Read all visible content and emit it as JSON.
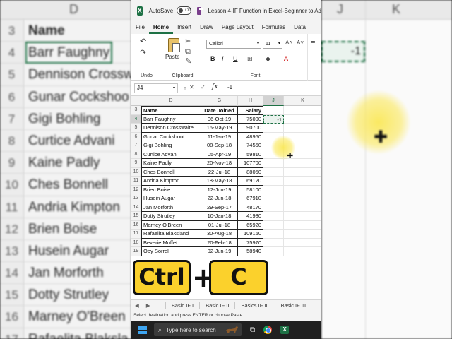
{
  "app": {
    "autosave_label": "AutoSave",
    "autosave_state": "Off",
    "doc_title": "Lesson 4-IF Function in Excel-Beginner to Ad"
  },
  "menu_tabs": [
    "File",
    "Home",
    "Insert",
    "Draw",
    "Page Layout",
    "Formulas",
    "Data"
  ],
  "ribbon": {
    "paste_label": "Paste",
    "undo_group": "Undo",
    "clipboard_group": "Clipboard",
    "font_group": "Font",
    "font_name": "Calibri",
    "font_size": "11",
    "bold": "B",
    "italic": "I",
    "underline": "U"
  },
  "formula_bar": {
    "cell_ref": "J4",
    "fx": "fx",
    "value": "-1"
  },
  "grid": {
    "columns": [
      "D",
      "G",
      "H",
      "J",
      "K"
    ],
    "selected_col": "J",
    "header_row": {
      "row": "3",
      "name": "Name",
      "date": "Date Joined",
      "salary": "Salary"
    },
    "rows": [
      {
        "row": "4",
        "name": "Barr Faughny",
        "date": "06-Oct-19",
        "salary": "75000",
        "j": "-1"
      },
      {
        "row": "5",
        "name": "Dennison Crosswaite",
        "date": "16-May-19",
        "salary": "90700"
      },
      {
        "row": "6",
        "name": "Gunar Cockshoot",
        "date": "11-Jan-19",
        "salary": "48950"
      },
      {
        "row": "7",
        "name": "Gigi Bohling",
        "date": "08-Sep-18",
        "salary": "74550"
      },
      {
        "row": "8",
        "name": "Curtice Advani",
        "date": "05-Apr-19",
        "salary": "59810"
      },
      {
        "row": "9",
        "name": "Kaine Padly",
        "date": "20-Nov-18",
        "salary": "107700"
      },
      {
        "row": "10",
        "name": "Ches Bonnell",
        "date": "22-Jul-18",
        "salary": "88050"
      },
      {
        "row": "11",
        "name": "Andria Kimpton",
        "date": "18-May-18",
        "salary": "69120"
      },
      {
        "row": "12",
        "name": "Brien Boise",
        "date": "12-Jun-19",
        "salary": "58100"
      },
      {
        "row": "13",
        "name": "Husein Augar",
        "date": "22-Jun-18",
        "salary": "67910"
      },
      {
        "row": "14",
        "name": "Jan Morforth",
        "date": "29-Sep-17",
        "salary": "48170"
      },
      {
        "row": "15",
        "name": "Dotty Strutley",
        "date": "10-Jan-18",
        "salary": "41980"
      },
      {
        "row": "16",
        "name": "Marney O'Breen",
        "date": "01-Jul-18",
        "salary": "65920"
      },
      {
        "row": "17",
        "name": "Rafaelita Blaksland",
        "date": "30-Aug-18",
        "salary": "109160"
      },
      {
        "row": "18",
        "name": "Beverie Moffet",
        "date": "20-Feb-18",
        "salary": "75970"
      },
      {
        "row": "19",
        "name": "Oby Sorrel",
        "date": "02-Jun-19",
        "salary": "58940"
      }
    ]
  },
  "overlay_keys": {
    "ctrl": "Ctrl",
    "plus": "+",
    "c": "C"
  },
  "sheet_tabs": {
    "nav": [
      "◀",
      "▶",
      "..."
    ],
    "tabs": [
      "Basic IF I",
      "Basic IF II",
      "Basics IF III",
      "Basic IF III"
    ]
  },
  "status_bar": "Select destination and press ENTER or choose Paste",
  "taskbar": {
    "search_placeholder": "Type here to search"
  },
  "background": {
    "left_col_letter": "D",
    "right_col_letters": [
      "J",
      "K"
    ],
    "left_rows": [
      {
        "row": "3",
        "name": "Name"
      },
      {
        "row": "4",
        "name": "Barr Faughny"
      },
      {
        "row": "5",
        "name": "Dennison Crossw"
      },
      {
        "row": "6",
        "name": "Gunar Cockshoo"
      },
      {
        "row": "7",
        "name": "Gigi Bohling"
      },
      {
        "row": "8",
        "name": "Curtice Advani"
      },
      {
        "row": "9",
        "name": "Kaine Padly"
      },
      {
        "row": "10",
        "name": "Ches Bonnell"
      },
      {
        "row": "11",
        "name": "Andria Kimpton"
      },
      {
        "row": "12",
        "name": "Brien Boise"
      },
      {
        "row": "13",
        "name": "Husein Augar"
      },
      {
        "row": "14",
        "name": "Jan Morforth"
      },
      {
        "row": "15",
        "name": "Dotty Strutley"
      },
      {
        "row": "16",
        "name": "Marney O'Breen"
      },
      {
        "row": "17",
        "name": "Rafaelita Blaksla"
      }
    ],
    "right_value": "-1"
  },
  "colors": {
    "excel_green": "#1e7145",
    "key_yellow": "#fbd12c",
    "highlight": "#fae85a"
  }
}
